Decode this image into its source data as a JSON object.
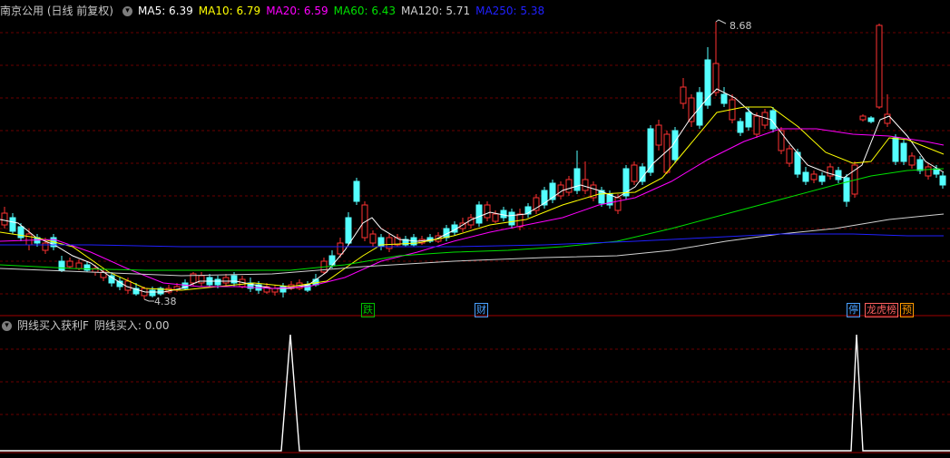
{
  "main_header": {
    "title": "南京公用 (日线 前复权)",
    "ma5": "MA5: 6.39",
    "ma10": "MA10: 6.79",
    "ma20": "MA20: 6.59",
    "ma60": "MA60: 6.43",
    "ma120": "MA120: 5.71",
    "ma250": "MA250: 5.38"
  },
  "sub_header": {
    "title": "阴线买入获利F",
    "value": "阴线买入: 0.00"
  },
  "price_labels": {
    "high": "8.68",
    "low": "4.38"
  },
  "badges": [
    {
      "text": "跌",
      "color": "#00c000"
    },
    {
      "text": "财",
      "color": "#4aa0ff"
    },
    {
      "text": "停",
      "color": "#4aa0ff"
    },
    {
      "text": "龙虎榜",
      "color": "#ff6060"
    },
    {
      "text": "预",
      "color": "#ff9900"
    }
  ],
  "colors": {
    "up": "#ff3232",
    "down": "#54ffff",
    "ma5": "#ffffff",
    "ma10": "#ffff00",
    "ma20": "#ff00ff",
    "ma60": "#00e000",
    "ma120": "#d0d0d0",
    "ma250": "#2020ff",
    "grid": "#6a0000",
    "sub_line": "#ffffff"
  },
  "icons": {
    "main_dropdown": "chevron-down-icon",
    "sub_dropdown": "chevron-down-icon"
  }
}
